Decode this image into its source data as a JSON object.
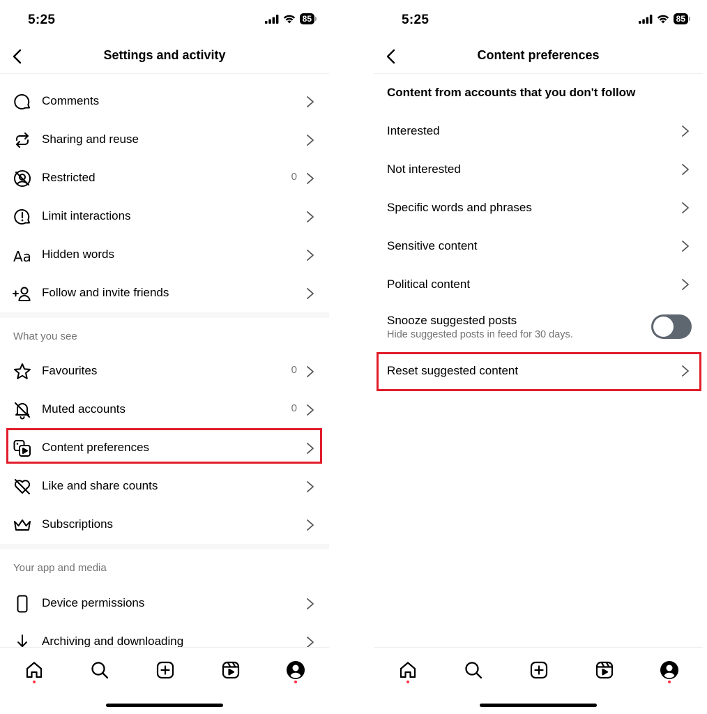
{
  "left": {
    "status": {
      "time": "5:25",
      "battery": "85"
    },
    "header": {
      "title": "Settings and activity"
    },
    "items_top": [
      {
        "label": "Comments",
        "icon": "comment-icon"
      },
      {
        "label": "Sharing and reuse",
        "icon": "sharing-icon"
      },
      {
        "label": "Restricted",
        "icon": "restricted-icon",
        "count": "0"
      },
      {
        "label": "Limit interactions",
        "icon": "limit-interactions-icon"
      },
      {
        "label": "Hidden words",
        "icon": "hidden-words-icon"
      },
      {
        "label": "Follow and invite friends",
        "icon": "add-person-icon"
      }
    ],
    "section_what_you_see": "What you see",
    "items_what_you_see": [
      {
        "label": "Favourites",
        "icon": "star-icon",
        "count": "0"
      },
      {
        "label": "Muted accounts",
        "icon": "muted-bell-icon",
        "count": "0"
      },
      {
        "label": "Content preferences",
        "icon": "content-preferences-icon"
      },
      {
        "label": "Like and share counts",
        "icon": "heart-off-icon"
      },
      {
        "label": "Subscriptions",
        "icon": "crown-icon"
      }
    ],
    "section_app_media": "Your app and media",
    "items_app_media": [
      {
        "label": "Device permissions",
        "icon": "phone-icon"
      },
      {
        "label": "Archiving and downloading",
        "icon": "download-icon"
      }
    ]
  },
  "right": {
    "status": {
      "time": "5:25",
      "battery": "85"
    },
    "header": {
      "title": "Content preferences"
    },
    "heading": "Content from accounts that you don't follow",
    "items": [
      {
        "label": "Interested"
      },
      {
        "label": "Not interested"
      },
      {
        "label": "Specific words and phrases"
      },
      {
        "label": "Sensitive content"
      },
      {
        "label": "Political content"
      }
    ],
    "snooze": {
      "title": "Snooze suggested posts",
      "subtitle": "Hide suggested posts in feed for 30 days.",
      "enabled": false
    },
    "reset": {
      "label": "Reset suggested content"
    }
  },
  "tabbar": [
    "home-icon",
    "search-icon",
    "create-icon",
    "reels-icon",
    "profile-icon"
  ],
  "colors": {
    "highlight": "#e11d2a",
    "notification_dot": "#ff3040",
    "secondary_text": "#737373",
    "toggle_off": "#5e6670"
  }
}
